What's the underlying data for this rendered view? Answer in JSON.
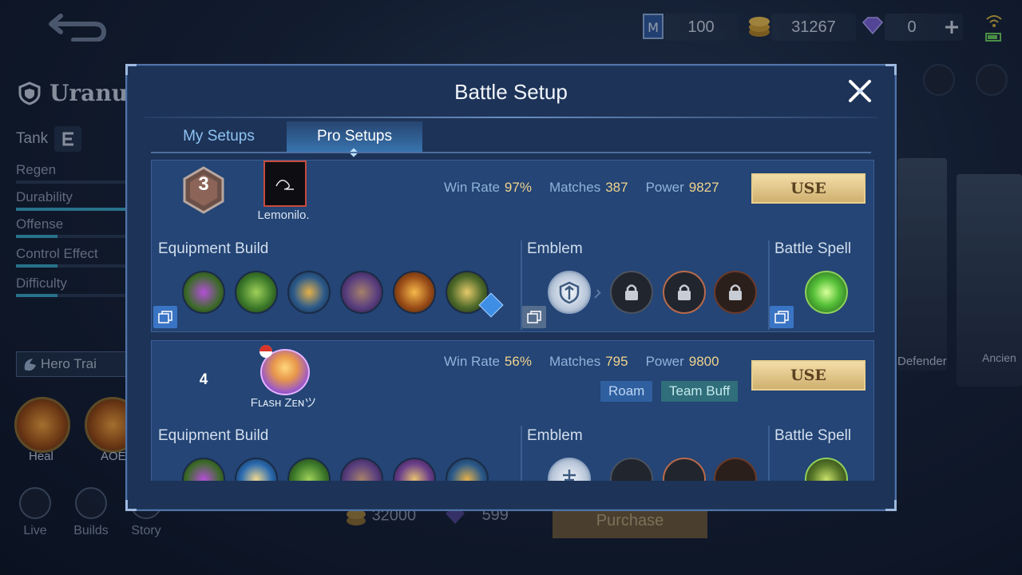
{
  "topbar": {
    "ticket_value": "100",
    "gold_value": "31267",
    "diamond_value": "0"
  },
  "hero": {
    "name": "Uranu",
    "role": "Tank",
    "stats": [
      "Regen",
      "Durability",
      "Offense",
      "Control Effect",
      "Difficulty"
    ],
    "hero_train_label": "Hero Trai",
    "skills": [
      {
        "label": "Heal"
      },
      {
        "label": "AOE"
      }
    ],
    "side_cards": [
      "Defender",
      "Ancien"
    ]
  },
  "bottom_nav": [
    {
      "label": "Live"
    },
    {
      "label": "Builds"
    },
    {
      "label": "Story"
    }
  ],
  "purchase": {
    "gold_price": "32000",
    "diamond_price": "599",
    "button_label": "Purchase"
  },
  "modal": {
    "title": "Battle Setup",
    "tabs": [
      {
        "label": "My Setups"
      },
      {
        "label": "Pro Setups",
        "active": true
      }
    ]
  },
  "setups": [
    {
      "rank": "3",
      "player": "Lemonilo.",
      "win_rate_label": "Win Rate",
      "win_rate": "97%",
      "matches_label": "Matches",
      "matches": "387",
      "power_label": "Power",
      "power": "9827",
      "use_label": "USE",
      "equipment_label": "Equipment Build",
      "emblem_label": "Emblem",
      "spell_label": "Battle Spell"
    },
    {
      "rank": "4",
      "player": "Fʟᴀsʜ Zᴇɴツ",
      "win_rate_label": "Win Rate",
      "win_rate": "56%",
      "matches_label": "Matches",
      "matches": "795",
      "power_label": "Power",
      "power": "9800",
      "use_label": "USE",
      "tags": [
        "Roam",
        "Team Buff"
      ],
      "equipment_label": "Equipment Build",
      "emblem_label": "Emblem",
      "spell_label": "Battle Spell"
    }
  ],
  "colors": {
    "accent": "#f1d38e",
    "tab_active": "#4696dc",
    "use_button": "#e3c98a"
  }
}
